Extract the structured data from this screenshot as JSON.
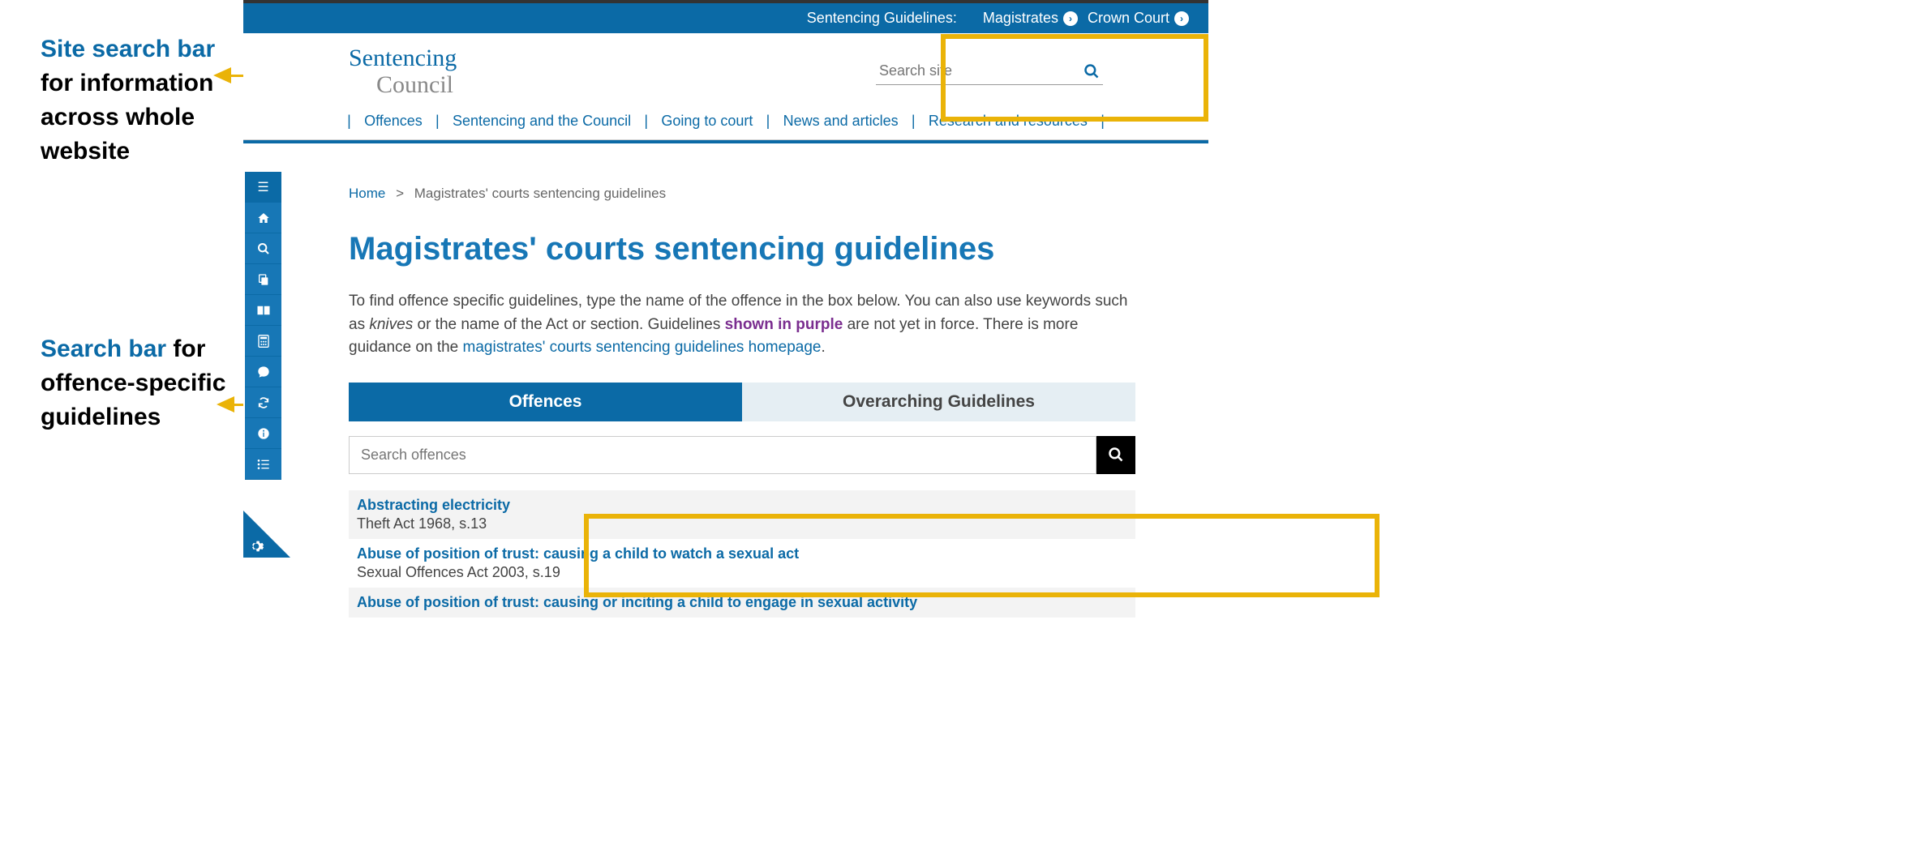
{
  "annotations": {
    "site_search": {
      "highlight": "Site search bar",
      "rest": " for information across whole website"
    },
    "offence_search": {
      "highlight": "Search bar",
      "rest": " for offence-specific guidelines"
    }
  },
  "top_bar": {
    "label": "Sentencing Guidelines:",
    "magistrates": "Magistrates",
    "crown_court": "Crown Court"
  },
  "logo": {
    "line1": "Sentencing",
    "line2": "Council"
  },
  "site_search": {
    "placeholder": "Search site"
  },
  "main_nav": {
    "offences": "Offences",
    "sentencing": "Sentencing and the Council",
    "court": "Going to court",
    "news": "News and articles",
    "research": "Research and resources"
  },
  "sidebar_icons": {
    "menu": "menu-icon",
    "home": "home-icon",
    "search": "search-icon",
    "copy": "copy-icon",
    "book": "book-icon",
    "calc": "calculator-icon",
    "comment": "comment-icon",
    "refresh": "refresh-icon",
    "info": "info-icon",
    "list": "list-icon"
  },
  "breadcrumb": {
    "home": "Home",
    "current": "Magistrates' courts sentencing guidelines"
  },
  "page_title": "Magistrates' courts sentencing guidelines",
  "intro": {
    "p1a": "To find offence specific guidelines, type the name of the offence in the box below. You can also use keywords such as ",
    "p1b": "knives",
    "p1c": " or the name of the Act or section. Guidelines ",
    "p1d": "shown in purple",
    "p1e": " are not yet in force. There is more guidance on the ",
    "p1f": "magistrates' courts sentencing guidelines homepage",
    "p1g": "."
  },
  "tabs": {
    "offences": "Offences",
    "overarching": "Overarching Guidelines"
  },
  "offence_search": {
    "placeholder": "Search offences"
  },
  "offences": [
    {
      "title": "Abstracting electricity",
      "meta": "Theft Act 1968, s.13"
    },
    {
      "title": "Abuse of position of trust: causing a child to watch a sexual act",
      "meta": "Sexual Offences Act 2003, s.19"
    },
    {
      "title": "Abuse of position of trust: causing or inciting a child to engage in sexual activity",
      "meta": ""
    }
  ]
}
